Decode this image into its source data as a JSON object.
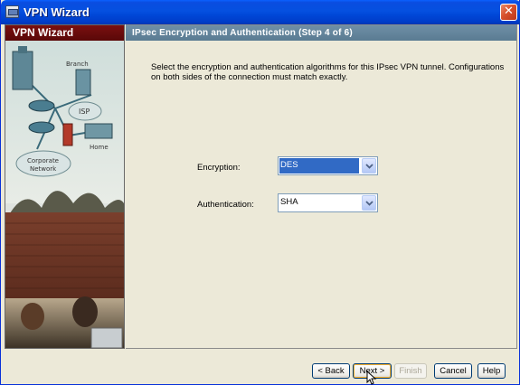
{
  "window": {
    "title": "VPN Wizard",
    "close_glyph": "✕"
  },
  "sidebar": {
    "title": "VPN Wizard",
    "art_labels": {
      "branch": "Branch",
      "isp": "ISP",
      "home": "Home",
      "corporate_line1": "Corporate",
      "corporate_line2": "Network"
    }
  },
  "step": {
    "title": "IPsec Encryption and Authentication  (Step 4 of 6)",
    "instruction_line1": "Select the encryption and authentication algorithms for this IPsec VPN tunnel. Configurations",
    "instruction_line2": "on both sides of the connection must match exactly."
  },
  "fields": {
    "encryption": {
      "label": "Encryption:",
      "value": "DES"
    },
    "authentication": {
      "label": "Authentication:",
      "value": "SHA"
    }
  },
  "buttons": {
    "back": "< Back",
    "next": "Next >",
    "finish": "Finish",
    "cancel": "Cancel",
    "help": "Help"
  },
  "colors": {
    "titlebar": "#0550e0",
    "sidebar_header": "#6a0c0c",
    "content_header": "#6482a0",
    "selection": "#316ac5"
  },
  "icons": [
    "app-icon",
    "close-icon",
    "dropdown-arrow-icon",
    "mouse-pointer-icon"
  ]
}
